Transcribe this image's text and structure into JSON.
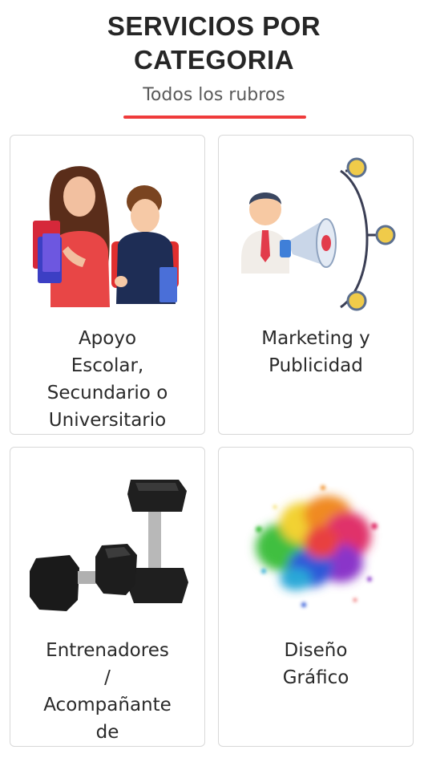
{
  "header": {
    "title_line1": "SERVICIOS POR",
    "title_line2": "CATEGORIA",
    "subtitle": "Todos los rubros",
    "underline_color": "#ef3b3b"
  },
  "categories": [
    {
      "label": "Apoyo\nEscolar,\nSecundario o\nUniversitario",
      "image": "students-illustration"
    },
    {
      "label": "Marketing y\nPublicidad",
      "image": "megaphone-network-icon"
    },
    {
      "label": "Entrenadores\n/\nAcompañante\nde",
      "image": "dumbbells-illustration"
    },
    {
      "label": "Diseño\nGráfico",
      "image": "color-powder-burst"
    }
  ]
}
